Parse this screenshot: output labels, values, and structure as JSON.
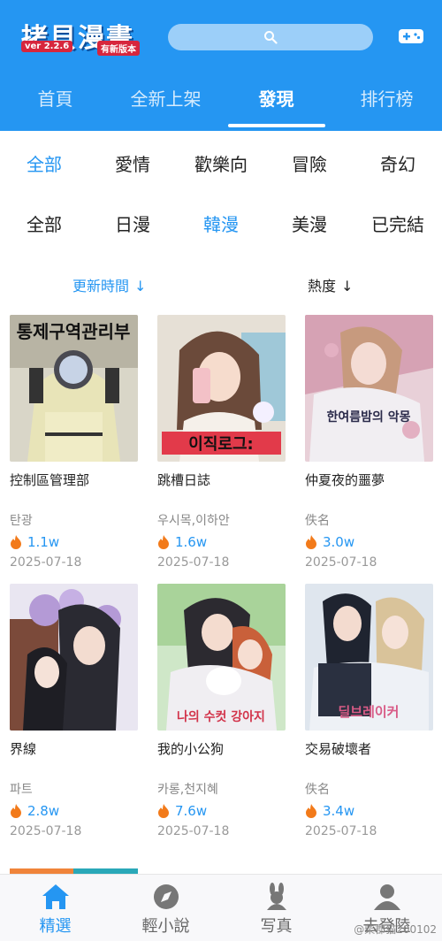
{
  "app": {
    "logo_title": "拷貝漫畫",
    "version": "ver 2.2.6",
    "badge": "有新版本",
    "search_icon": "search-icon",
    "game_icon": "gamepad-icon",
    "brand_color": "#2596f2"
  },
  "top_tabs": [
    {
      "label": "首頁"
    },
    {
      "label": "全新上架"
    },
    {
      "label": "發現",
      "active": true
    },
    {
      "label": "排行榜"
    }
  ],
  "filters": {
    "genres": [
      {
        "label": "全部",
        "active": true
      },
      {
        "label": "愛情"
      },
      {
        "label": "歡樂向"
      },
      {
        "label": "冒險"
      },
      {
        "label": "奇幻"
      }
    ],
    "regions": [
      {
        "label": "全部"
      },
      {
        "label": "日漫"
      },
      {
        "label": "韓漫",
        "active": true
      },
      {
        "label": "美漫"
      },
      {
        "label": "已完結"
      }
    ],
    "sort": [
      {
        "label": "更新時間",
        "active": true
      },
      {
        "label": "熱度"
      }
    ]
  },
  "comics": [
    {
      "title": "控制區管理部",
      "author": "탄광",
      "heat": "1.1w",
      "date": "2025-07-18",
      "cover_text": "통제구역관리부"
    },
    {
      "title": "跳槽日誌",
      "author": "우시목,이하안",
      "heat": "1.6w",
      "date": "2025-07-18",
      "cover_text": "이직로그:"
    },
    {
      "title": "仲夏夜的噩夢",
      "author": "佚名",
      "heat": "3.0w",
      "date": "2025-07-18",
      "cover_text": "한여름밤의 악몽"
    },
    {
      "title": "界線",
      "author": "파트",
      "heat": "2.8w",
      "date": "2025-07-18",
      "cover_text": ""
    },
    {
      "title": "我的小公狗",
      "author": "카롱,천지혜",
      "heat": "7.6w",
      "date": "2025-07-18",
      "cover_text": "나의 수컷 강아지"
    },
    {
      "title": "交易破壞者",
      "author": "佚名",
      "heat": "3.4w",
      "date": "2025-07-18",
      "cover_text": "딜브레이커"
    }
  ],
  "bottom_nav": [
    {
      "label": "精選",
      "icon": "home-icon",
      "active": true
    },
    {
      "label": "輕小說",
      "icon": "compass-icon"
    },
    {
      "label": "写真",
      "icon": "bunny-icon"
    },
    {
      "label": "去登陸",
      "icon": "user-icon"
    }
  ],
  "watermark": "@柴郡猫200102"
}
